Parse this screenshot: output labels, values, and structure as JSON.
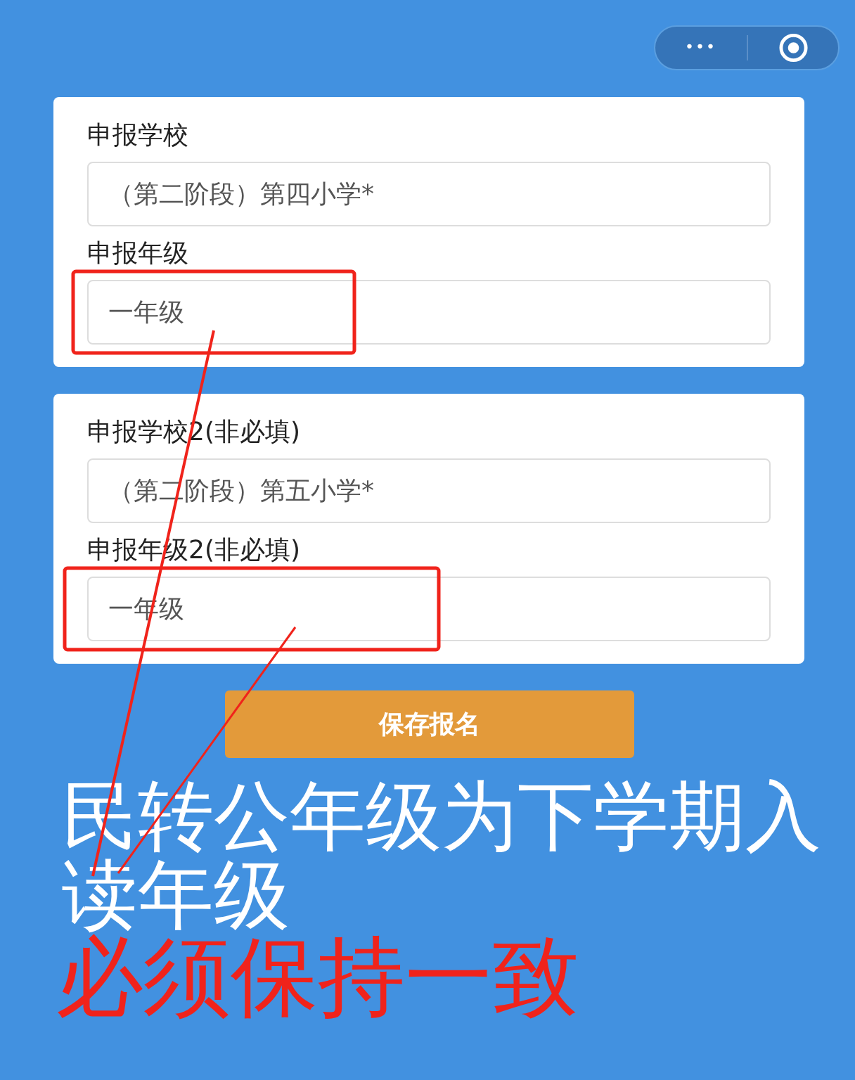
{
  "capsule": {
    "more": "•••"
  },
  "forms": [
    {
      "fields": [
        {
          "label": "申报学校",
          "value": "（第二阶段）第四小学*",
          "highlighted": false
        },
        {
          "label": "申报年级",
          "value": "一年级",
          "highlighted": true
        }
      ]
    },
    {
      "fields": [
        {
          "label": "申报学校2(非必填)",
          "value": "（第二阶段）第五小学*",
          "highlighted": false
        },
        {
          "label": "申报年级2(非必填)",
          "value": "一年级",
          "highlighted": true
        }
      ]
    }
  ],
  "submit_button": "保存报名",
  "annotation": {
    "note": "民转公年级为下学期入读年级",
    "warning": "必须保持一致"
  }
}
